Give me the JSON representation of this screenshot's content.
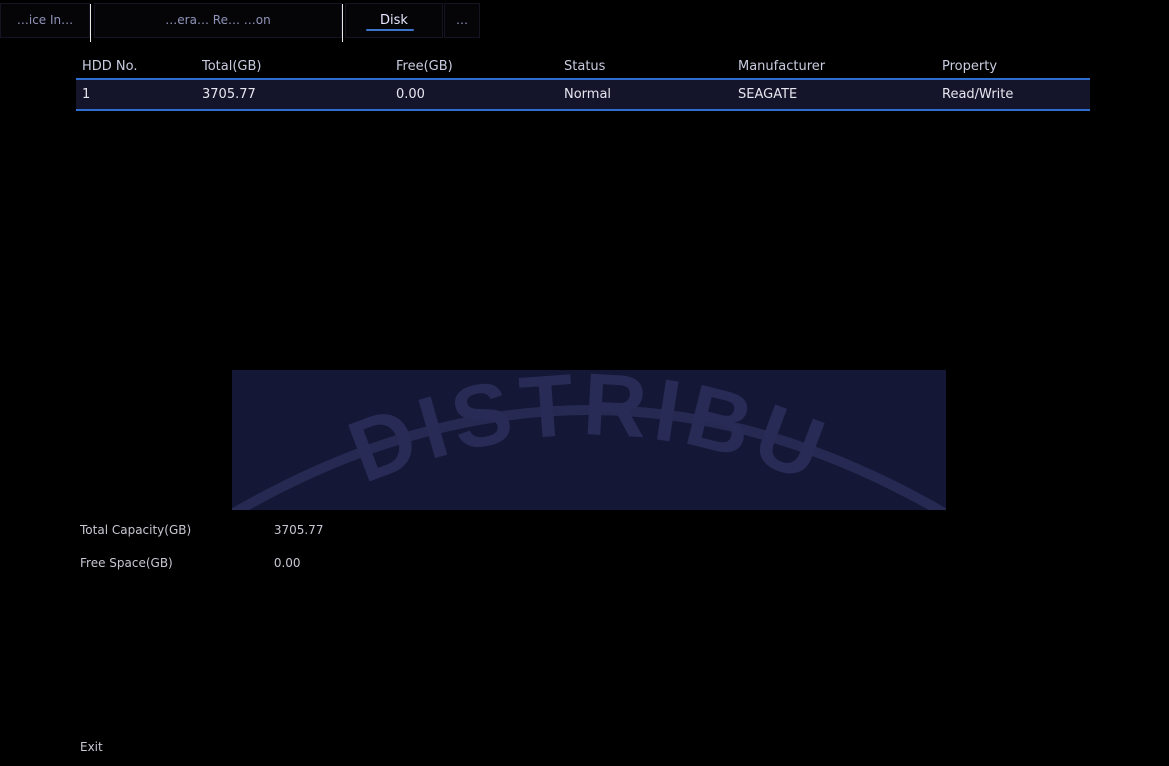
{
  "tabs": [
    {
      "label": "…ice In…",
      "active": false
    },
    {
      "label": "…era… Re… …on",
      "active": false
    },
    {
      "label": "Disk",
      "active": true
    },
    {
      "label": "…",
      "active": false
    }
  ],
  "table": {
    "columns": [
      "HDD No.",
      "Total(GB)",
      "Free(GB)",
      "Status",
      "Manufacturer",
      "Property"
    ],
    "rows": [
      {
        "hdd_no": "1",
        "total": "3705.77",
        "free": "0.00",
        "status": "Normal",
        "manufacturer": "SEAGATE",
        "property": "Read/Write"
      }
    ]
  },
  "watermark": {
    "text": "DISTRIBU"
  },
  "summary": {
    "total_capacity_label": "Total Capacity(GB)",
    "total_capacity_value": "3705.77",
    "free_space_label": "Free Space(GB)",
    "free_space_value": "0.00"
  },
  "exit_label": "Exit",
  "colors": {
    "accent": "#2f6ed1",
    "background": "#000000",
    "row_bg": "#14152a"
  }
}
